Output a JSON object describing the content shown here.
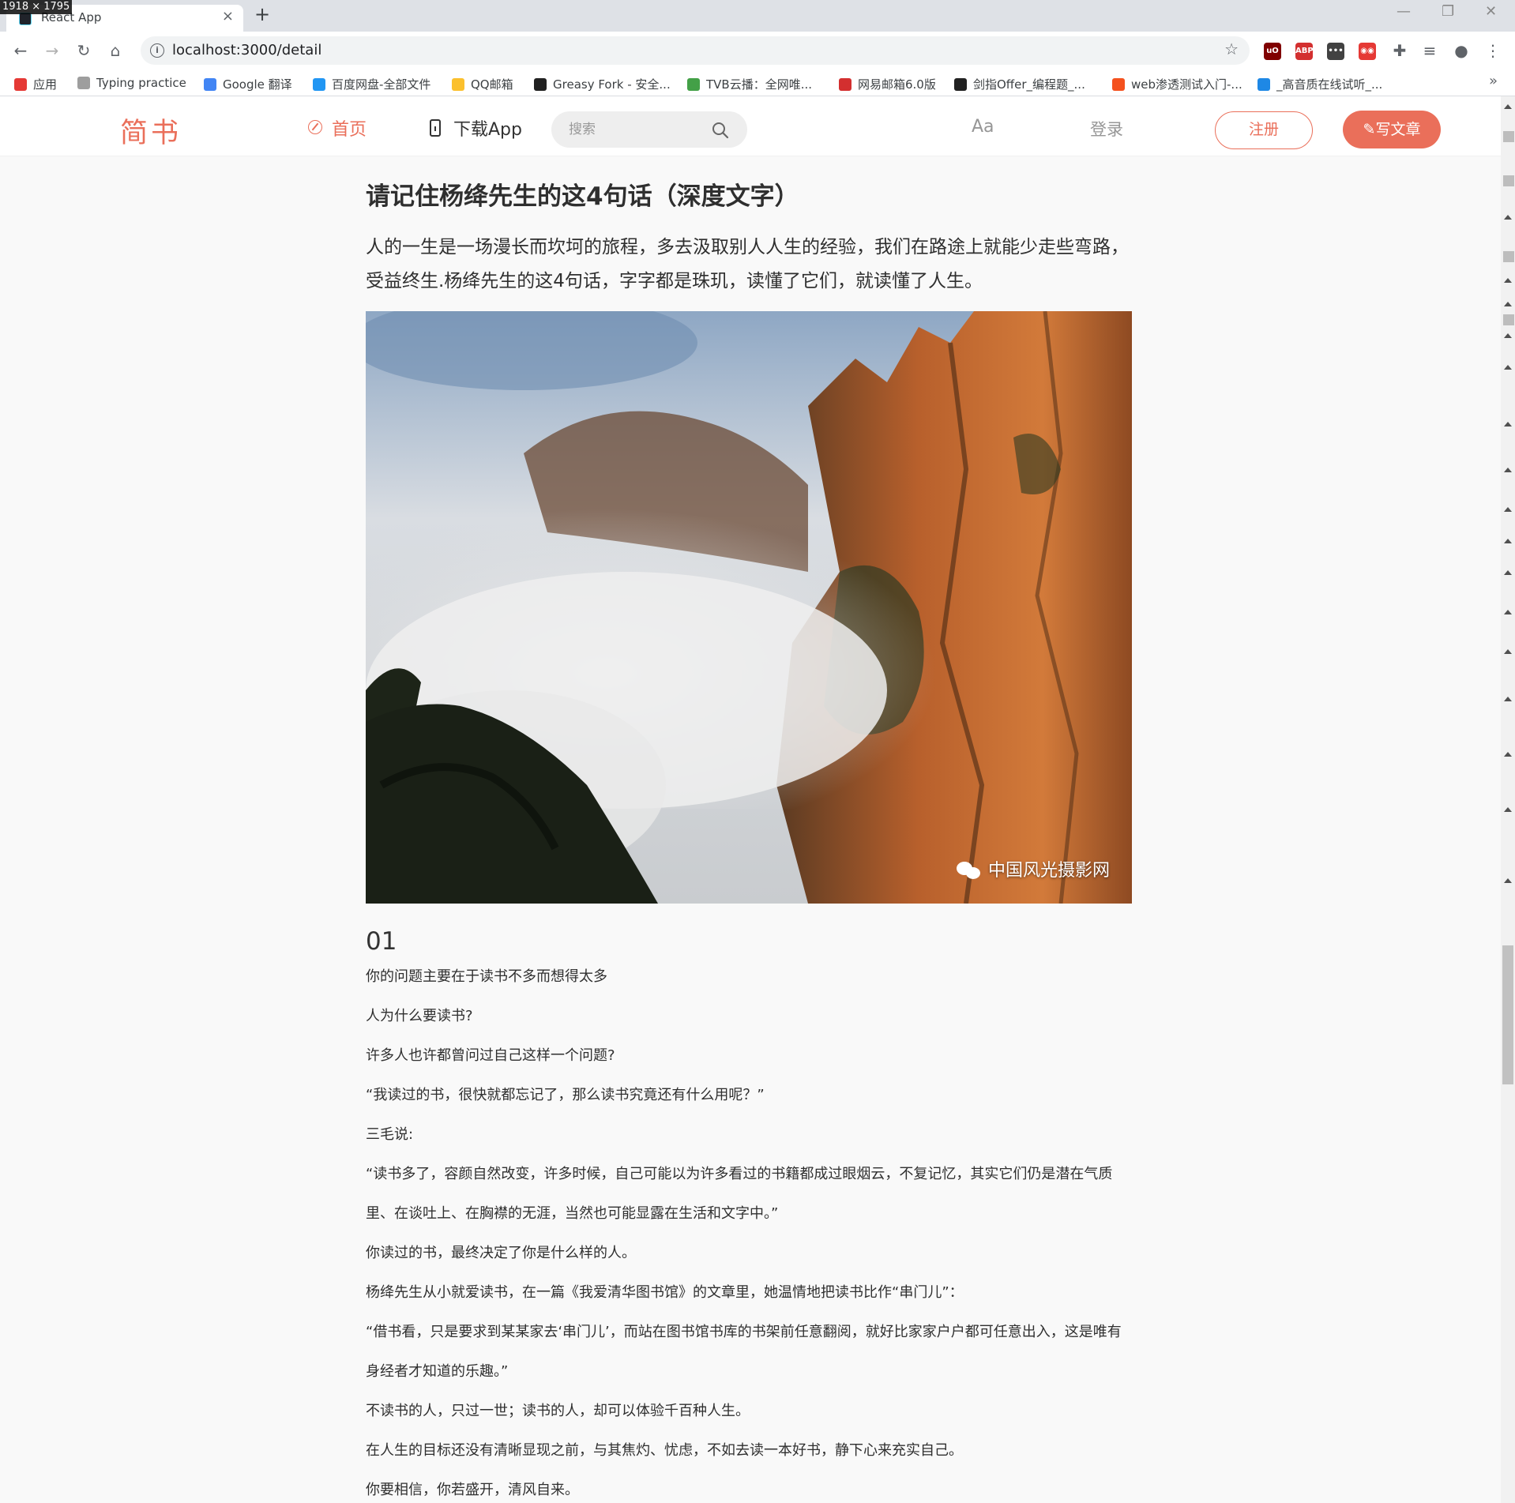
{
  "screen_badge": "1918 × 1795",
  "browser": {
    "tab_title": "React App",
    "tab_close": "×",
    "new_tab": "+",
    "url": "localhost:3000/detail",
    "nav": {
      "back": "←",
      "forward": "→",
      "reload": "↻",
      "home": "⌂"
    },
    "window_controls": {
      "minimize": "—",
      "restore": "❐",
      "close": "✕"
    },
    "bookmarks": [
      {
        "label": "应用",
        "color": "#e53935"
      },
      {
        "label": "Typing practice",
        "color": "#9e9e9e"
      },
      {
        "label": "Google 翻译",
        "color": "#4285f4"
      },
      {
        "label": "百度网盘-全部文件",
        "color": "#2196f3"
      },
      {
        "label": "QQ邮箱",
        "color": "#fbc02d"
      },
      {
        "label": "Greasy Fork - 安全...",
        "color": "#212121"
      },
      {
        "label": "TVB云播：全网唯...",
        "color": "#43a047"
      },
      {
        "label": "网易邮箱6.0版",
        "color": "#d32f2f"
      },
      {
        "label": "剑指Offer_编程题_...",
        "color": "#212121"
      },
      {
        "label": "web渗透测试入门-...",
        "color": "#f4511e"
      },
      {
        "label": "_高音质在线试听_...",
        "color": "#1e88e5"
      }
    ],
    "bookmarks_more": "»",
    "extensions": [
      {
        "name": "ublock",
        "label": "uO",
        "color": "#800000"
      },
      {
        "name": "adblock-plus",
        "label": "ABP",
        "color": "#d32f2f"
      },
      {
        "name": "dots-extension",
        "label": "•••",
        "color": "#424242"
      },
      {
        "name": "red-extension",
        "label": "◉◉",
        "color": "#e53935"
      }
    ]
  },
  "header": {
    "logo": "简书",
    "nav_home": "首页",
    "nav_app": "下载App",
    "search_placeholder": "搜索",
    "font_toggle": "Aa",
    "login": "登录",
    "register": "注册",
    "write": "写文章",
    "accent_color": "#ea6f5a"
  },
  "article": {
    "title": "请记住杨绛先生的这4句话（深度文字）",
    "lead": "人的一生是一场漫长而坎坷的旅程，多去汲取别人人生的经验，我们在路途上就能少走些弯路，受益终生.杨绛先生的这4句话，字字都是珠玑，读懂了它们，就读懂了人生。",
    "image_watermark": "中国风光摄影网",
    "section_number": "01",
    "paragraphs": [
      "你的问题主要在于读书不多而想得太多",
      "人为什么要读书?",
      "许多人也许都曾问过自己这样一个问题?",
      "“我读过的书，很快就都忘记了，那么读书究竟还有什么用呢？”",
      "三毛说:",
      "“读书多了，容颜自然改变，许多时候，自己可能以为许多看过的书籍都成过眼烟云，不复记忆，其实它们仍是潜在气质里、在谈吐上、在胸襟的无涯，当然也可能显露在生活和文字中。”",
      "你读过的书，最终决定了你是什么样的人。",
      "杨绛先生从小就爱读书，在一篇《我爱清华图书馆》的文章里，她温情地把读书比作“串门儿”：",
      "“借书看，只是要求到某某家去‘串门儿’，而站在图书馆书库的书架前任意翻阅，就好比家家户户都可任意出入，这是唯有身经者才知道的乐趣。”",
      "不读书的人，只过一世；读书的人，却可以体验千百种人生。",
      "在人生的目标还没有清晰显现之前，与其焦灼、忧虑，不如去读一本好书，静下心来充实自己。",
      "你要相信，你若盛开，清风自来。"
    ]
  }
}
